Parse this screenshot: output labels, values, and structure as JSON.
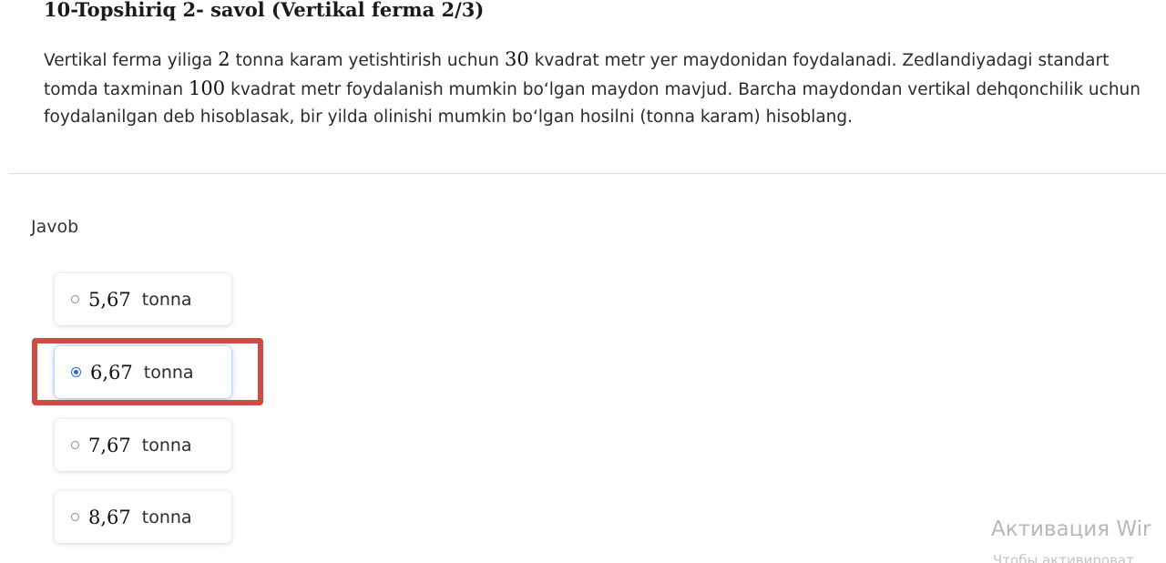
{
  "task": {
    "title": "10-Topshiriq 2- savol (Vertikal ferma 2/3)"
  },
  "question": {
    "part1": "Vertikal ferma yiliga",
    "num1": "2",
    "part2": "tonna karam yetishtirish uchun",
    "num2": "30",
    "part3": "kvadrat metr yer maydonidan foydalanadi. Zedlandiyadagi standart tomda taxminan",
    "num3": "100",
    "part4": "kvadrat metr foydalanish mumkin bo‘lgan maydon mavjud. Barcha maydondan vertikal dehqonchilik uchun foydalanilgan deb hisoblasak, bir yilda olinishi mumkin bo‘lgan hosilni (tonna karam) hisoblang."
  },
  "answer": {
    "label": "Javob",
    "options": [
      {
        "value": "5,67",
        "unit": "tonna",
        "selected": false
      },
      {
        "value": "6,67",
        "unit": "tonna",
        "selected": true
      },
      {
        "value": "7,67",
        "unit": "tonna",
        "selected": false
      },
      {
        "value": "8,67",
        "unit": "tonna",
        "selected": false
      }
    ]
  },
  "watermark": {
    "line1": "Активация Wir",
    "line2": "Чтобы активироват"
  },
  "colors": {
    "highlight": "#cc4b44",
    "radio_selected": "#2a6fd6"
  }
}
